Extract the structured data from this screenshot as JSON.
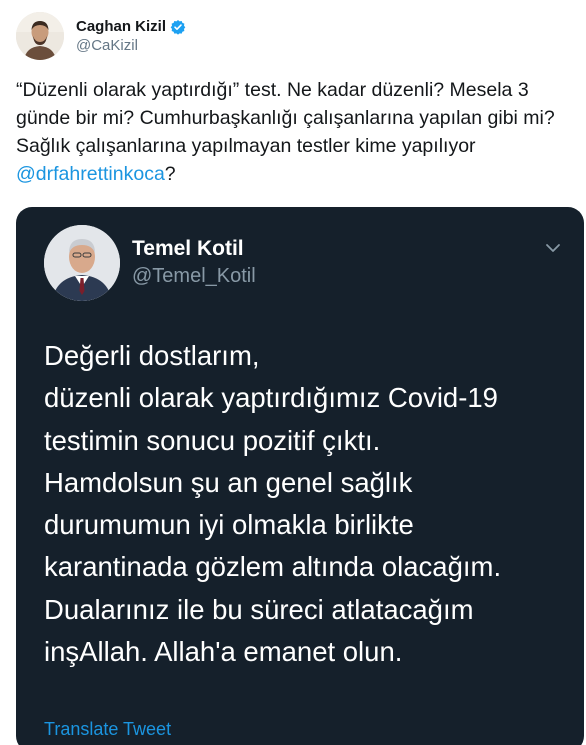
{
  "author": {
    "display_name": "Caghan Kizil",
    "handle": "@CaKizil",
    "avatar_icon": "person-avatar-icon",
    "verified_icon": "verified-badge-icon"
  },
  "tweet": {
    "text_before": "“Düzenli olarak yaptırdığı” test. Ne kadar düzenli? Mesela 3 günde bir mi? Cumhurbaşkanlığı çalışanlarına yapılan gibi mi? Sağlık çalışanlarına yapılmayan testler kime yapılıyor ",
    "mention": "@drfahrettinkoca",
    "text_after": "?"
  },
  "embedded_tweet": {
    "display_name": "Temel Kotil",
    "handle": "@Temel_Kotil",
    "avatar_icon": "person-avatar-icon",
    "menu_icon": "chevron-down-icon",
    "body": "Değerli dostlarım,\ndüzenli olarak yaptırdığımız Covid-19\ntestimin sonucu pozitif çıktı.\nHamdolsun şu an genel sağlık\ndurumumun iyi olmakla birlikte\nkarantinada gözlem altında olacağım.\nDualarınız ile bu süreci atlatacağım\ninşAllah. Allah'a emanet olun.",
    "translate_label": "Translate Tweet"
  },
  "colors": {
    "link": "#1b95e0",
    "dark_card": "#15202b",
    "secondary_text": "#657786"
  }
}
